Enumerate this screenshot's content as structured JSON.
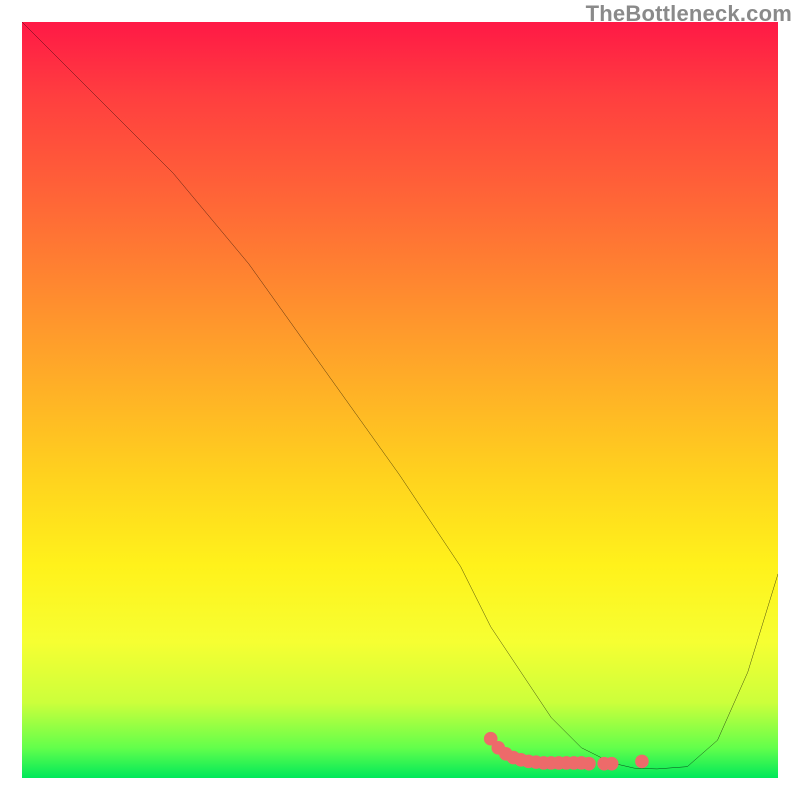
{
  "watermark": "TheBottleneck.com",
  "chart_data": {
    "type": "line",
    "title": "",
    "xlabel": "",
    "ylabel": "",
    "xlim": [
      0,
      100
    ],
    "ylim": [
      0,
      100
    ],
    "grid": false,
    "series": [
      {
        "name": "bottleneck-curve",
        "color": "#000000",
        "x": [
          0,
          8,
          20,
          30,
          40,
          50,
          58,
          62,
          66,
          70,
          74,
          78,
          81,
          84,
          88,
          92,
          96,
          100
        ],
        "values": [
          100,
          92,
          80,
          68,
          54,
          40,
          28,
          20,
          14,
          8,
          4,
          2,
          1.3,
          1.2,
          1.5,
          5,
          14,
          27
        ]
      }
    ],
    "markers": [
      {
        "name": "actual-point-highlight",
        "color": "#ed6a6a",
        "x": [
          62,
          63,
          64,
          65,
          66,
          67,
          68,
          69,
          70,
          71,
          72,
          73,
          74,
          75,
          77,
          78,
          82
        ],
        "y": [
          5.2,
          4.0,
          3.2,
          2.7,
          2.4,
          2.2,
          2.1,
          2.0,
          2.0,
          2.0,
          2.0,
          2.0,
          2.0,
          1.9,
          1.9,
          1.9,
          2.2
        ]
      }
    ]
  }
}
